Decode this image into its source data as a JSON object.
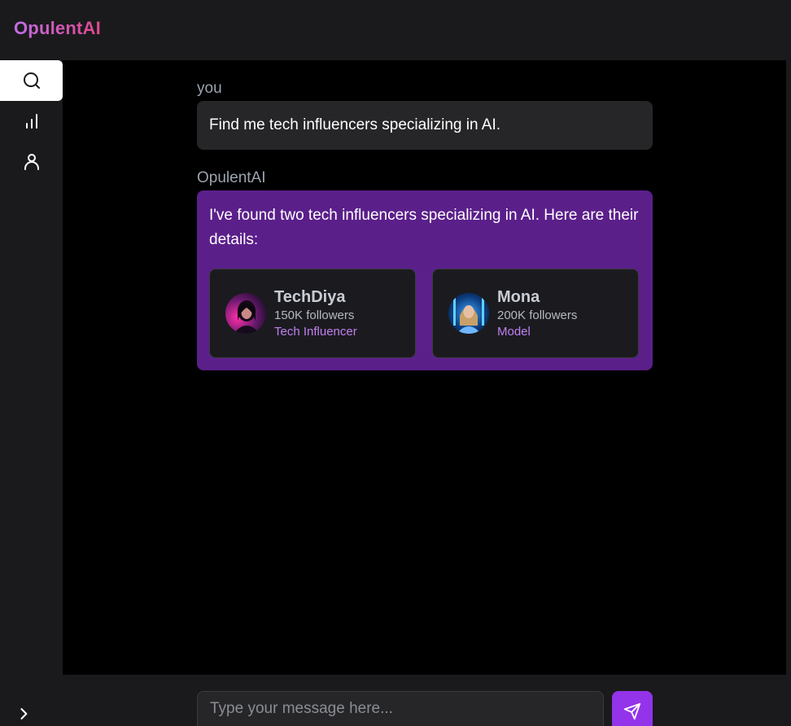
{
  "app": {
    "brand": "OpulentAI"
  },
  "sidebar": {
    "items": [
      {
        "icon": "search-icon",
        "active": true
      },
      {
        "icon": "bar-chart-icon",
        "active": false
      },
      {
        "icon": "user-icon",
        "active": false
      }
    ],
    "expand_icon": "chevron-right-icon"
  },
  "chat": {
    "messages": [
      {
        "sender": "you",
        "text": "Find me tech influencers specializing in AI."
      },
      {
        "sender": "OpulentAI",
        "text": "I've found two tech influencers specializing in AI. Here are their details:"
      }
    ],
    "influencers": [
      {
        "name": "TechDiya",
        "followers": "150K followers",
        "role": "Tech Influencer"
      },
      {
        "name": "Mona",
        "followers": "200K followers",
        "role": "Model"
      }
    ]
  },
  "composer": {
    "placeholder": "Type your message here...",
    "send_icon": "send-icon"
  },
  "colors": {
    "accent": "#9333ea",
    "ai_bubble": "#5b1f8a",
    "role_text": "#c27ff0",
    "brand_gradient_start": "#c16ee8",
    "brand_gradient_end": "#e0468a"
  }
}
